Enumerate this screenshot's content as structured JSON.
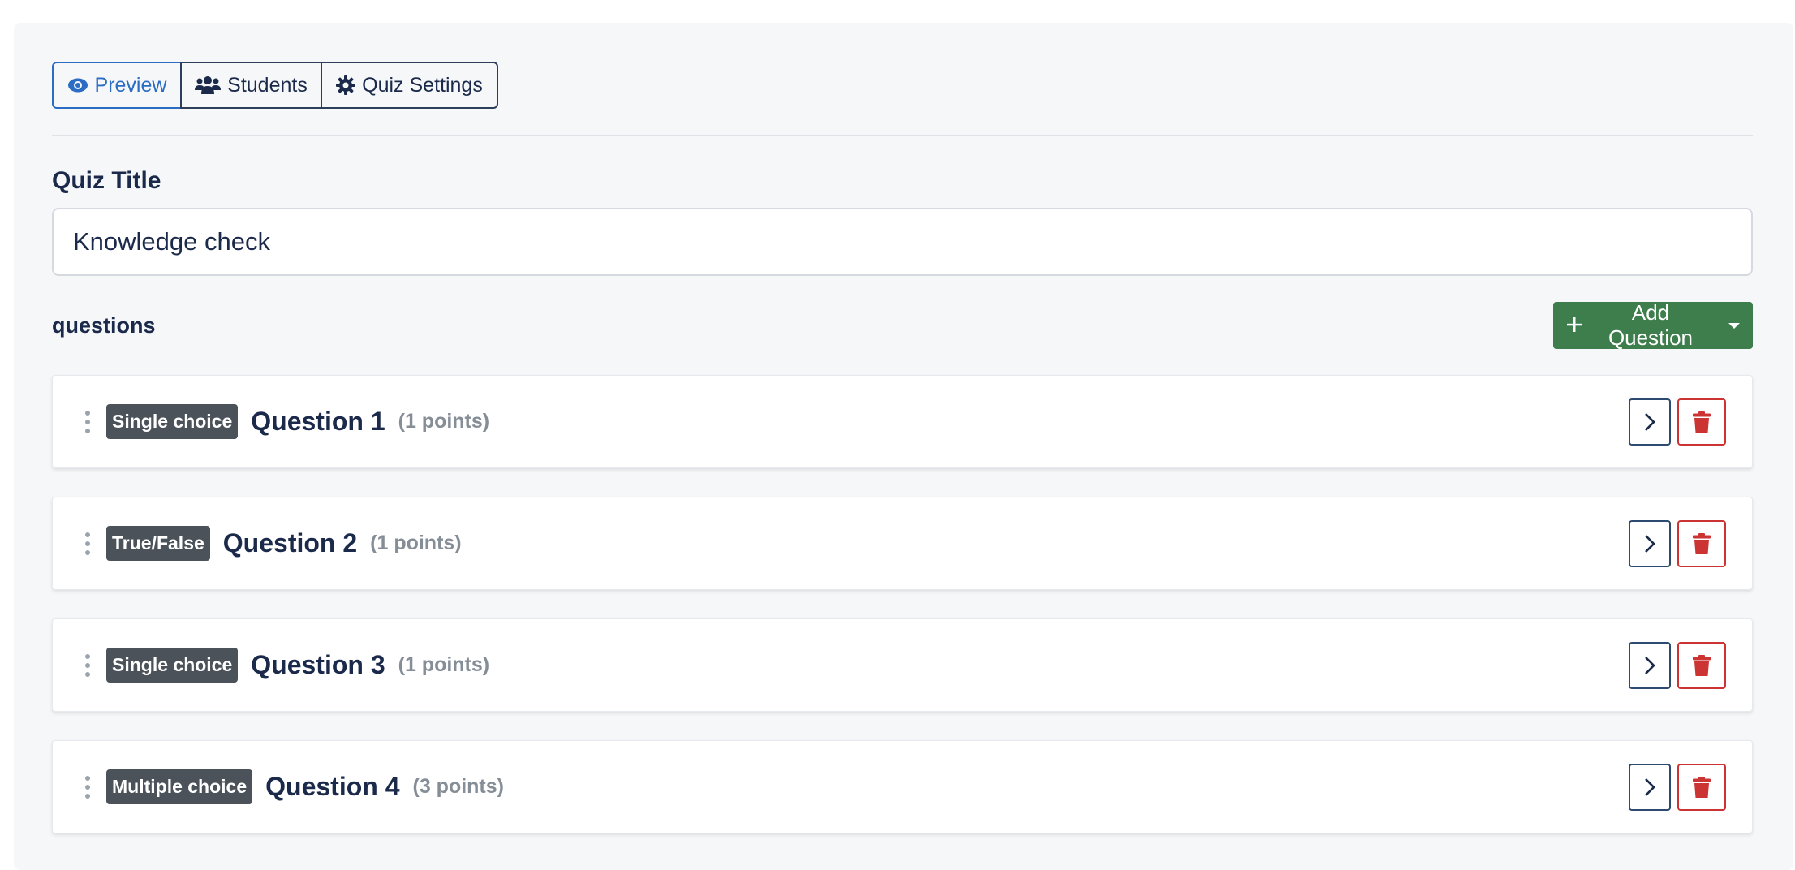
{
  "tabs": [
    {
      "label": "Preview",
      "icon": "eye-icon",
      "active": true
    },
    {
      "label": "Students",
      "icon": "users-icon",
      "active": false
    },
    {
      "label": "Quiz Settings",
      "icon": "gear-icon",
      "active": false
    }
  ],
  "quiz_title": {
    "label": "Quiz Title",
    "value": "Knowledge check"
  },
  "questions_heading": "questions",
  "add_question_label": "Add Question",
  "questions": [
    {
      "type": "Single choice",
      "title": "Question 1",
      "points": "(1 points)"
    },
    {
      "type": "True/False",
      "title": "Question 2",
      "points": "(1 points)"
    },
    {
      "type": "Single choice",
      "title": "Question 3",
      "points": "(1 points)"
    },
    {
      "type": "Multiple choice",
      "title": "Question 4",
      "points": "(3 points)"
    }
  ],
  "colors": {
    "accent_blue": "#2b6cc4",
    "navy": "#1b2a4a",
    "success_green": "#3e7d4c",
    "danger_red": "#cc3333",
    "badge_gray": "#4b525a"
  }
}
